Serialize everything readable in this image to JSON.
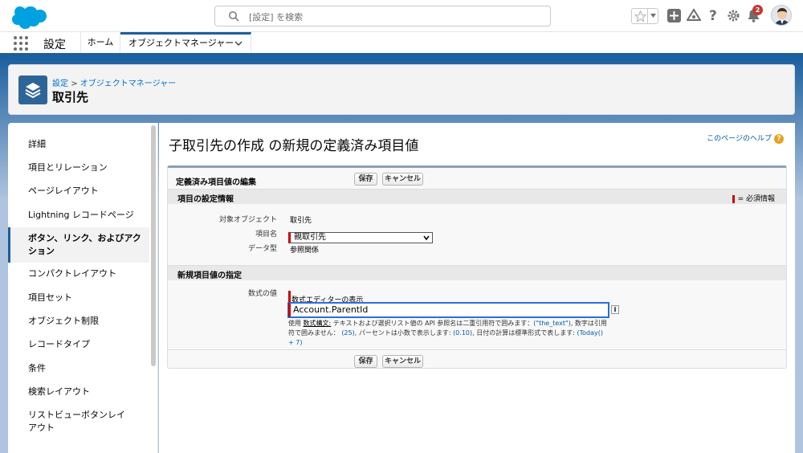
{
  "search": {
    "placeholder": "[設定] を検索"
  },
  "global": {
    "notification_count": "2"
  },
  "nav": {
    "app_name": "設定",
    "home_tab": "ホーム",
    "object_manager_tab": "オブジェクトマネージャー"
  },
  "header": {
    "crumb_root": "設定",
    "crumb_sep": ">",
    "crumb_child": "オブジェクトマネージャー",
    "title": "取引先"
  },
  "sidebar": {
    "items": [
      {
        "label": "詳細"
      },
      {
        "label": "項目とリレーション"
      },
      {
        "label": "ページレイアウト"
      },
      {
        "label": "Lightning レコードページ"
      },
      {
        "label": "ボタン、リンク、およびアクション"
      },
      {
        "label": "コンパクトレイアウト"
      },
      {
        "label": "項目セット"
      },
      {
        "label": "オブジェクト制限"
      },
      {
        "label": "レコードタイプ"
      },
      {
        "label": "条件"
      },
      {
        "label": "検索レイアウト"
      },
      {
        "label": "リストビューボタンレイアウト"
      }
    ],
    "active_index": 4
  },
  "page": {
    "title": "子取引先の作成 の新規の定義済み項目値",
    "help": "このページのヘルプ",
    "block_title": "定義済み項目値の編集",
    "save": "保存",
    "cancel": "キャンセル",
    "section1": "項目の設定情報",
    "required_legend": "= 必須情報",
    "target_object_label": "対象オブジェクト",
    "target_object_value": "取引先",
    "field_name_label": "項目名",
    "field_name_value": "親取引先",
    "data_type_label": "データ型",
    "data_type_value": "参照関係",
    "section2": "新規項目値の指定",
    "formula_label": "数式の値",
    "formula_editor_link": "数式エディターの表示",
    "formula_value": "Account.ParentId",
    "hint_use": "使用",
    "hint_syntax": "数式構文:",
    "hint_text1": "テキストおよび選択リスト値の API 参照名は二重引用符で囲みます：",
    "hint_ex1": "(\"the_text\")",
    "hint_text2": ", 数字は引用符で囲みません：",
    "hint_ex2": "(25)",
    "hint_text3": ", パーセントは小数で表示します:",
    "hint_ex3": "(0.10)",
    "hint_text4": ", 日付の計算は標準形式で表します:",
    "hint_ex4": "(Today() + 7)"
  }
}
